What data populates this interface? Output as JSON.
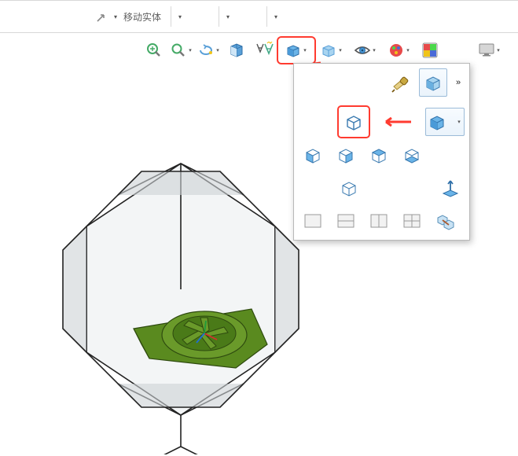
{
  "toolbar": {
    "move_solid_label": "移动实体",
    "popout_icon": "popout-icon",
    "dropdown_arrow": "▾"
  },
  "view_toolbar": {
    "icons": [
      "zoom-fit",
      "zoom-area",
      "rotate-view",
      "section-view",
      "dynamic-annotation",
      "view-orientation",
      "display-style",
      "hide-show",
      "appearance",
      "color-scheme",
      "monitor"
    ]
  },
  "flyout": {
    "row1": [
      "telescope-icon",
      "iso-cube-hover"
    ],
    "row2_selected": "wireframe-cube",
    "row2_right": "shaded-cube",
    "row3": [
      "front-cube",
      "back-cube",
      "left-cube",
      "right-cube"
    ],
    "row4": [
      "top-cube",
      "normal-to"
    ],
    "row5": [
      "single-vp",
      "two-vp-h",
      "two-vp-v",
      "four-vp",
      "linked-vp"
    ],
    "more": "»"
  },
  "colors": {
    "accent_blue": "#2e8bd8",
    "highlight_red": "#ff3b30"
  }
}
